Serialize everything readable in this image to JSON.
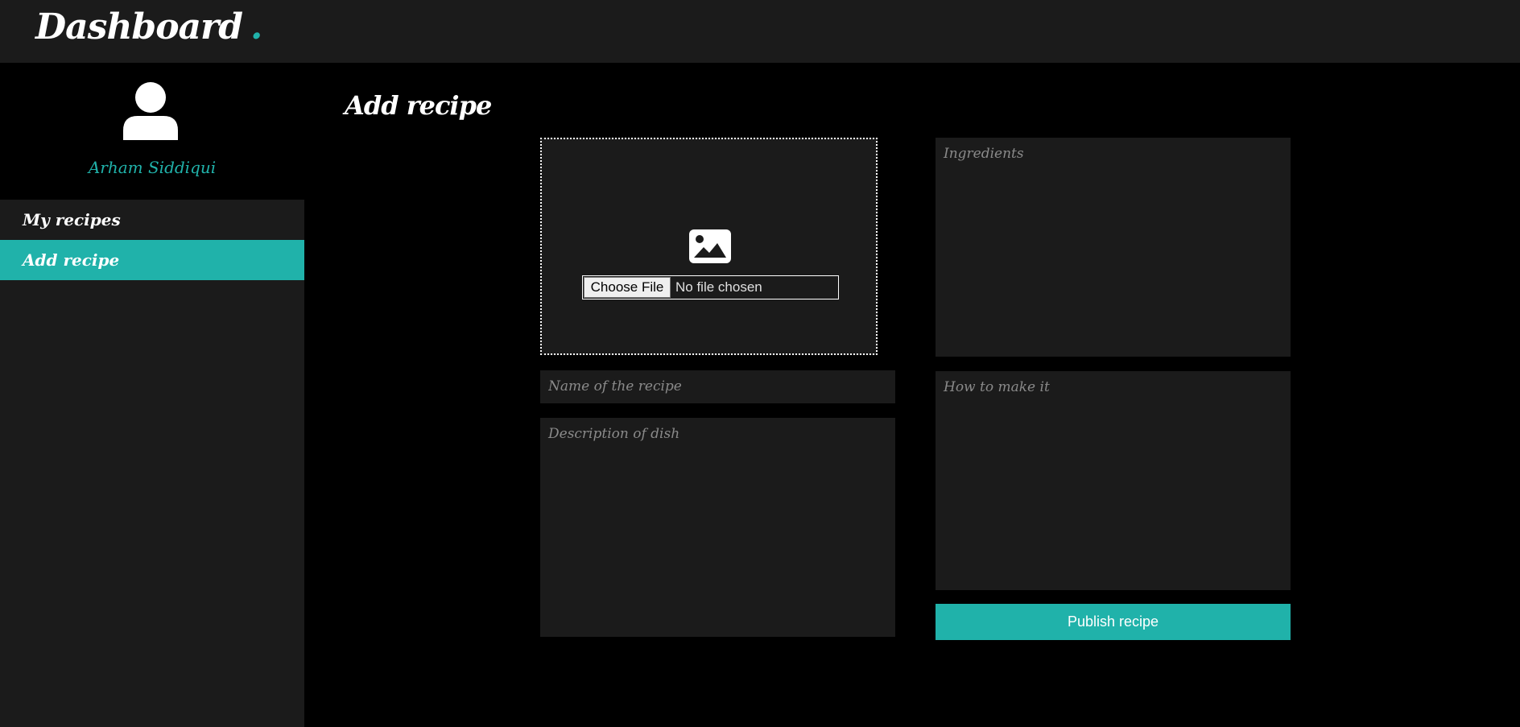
{
  "app": {
    "brand": "Dashboard",
    "brand_dot": ".",
    "accent_color": "#20b2aa",
    "panel_color": "#1b1b1b"
  },
  "sidebar": {
    "avatar_icon": "user-icon",
    "user_name": "Arham Siddiqui",
    "items": [
      {
        "label": "My recipes",
        "active": false
      },
      {
        "label": "Add recipe",
        "active": true
      }
    ]
  },
  "main": {
    "title": "Add recipe",
    "upload": {
      "icon": "image-icon",
      "choose_label": "Choose File",
      "status": "No file chosen"
    },
    "fields": {
      "name_placeholder": "Name of the recipe",
      "description_placeholder": "Description of dish",
      "ingredients_placeholder": "Ingredients",
      "method_placeholder": "How to make it"
    },
    "publish_label": "Publish recipe"
  }
}
